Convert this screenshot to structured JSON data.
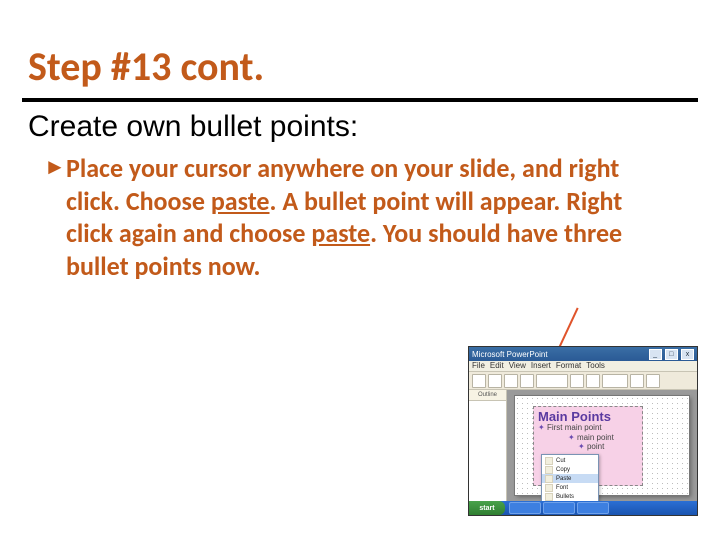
{
  "title": "Step #13 cont.",
  "subtitle": "Create own bullet points:",
  "bullet_glyph": "►",
  "body_parts": {
    "p1": "Place your cursor anywhere on your slide, and right click. Choose ",
    "paste1": "paste",
    "p2": ". A bullet point will appear. Right click again and choose ",
    "paste2": "paste",
    "p3": ". You should have three bullet points now."
  },
  "screenshot": {
    "window_title": "Microsoft PowerPoint",
    "menu_items": [
      "File",
      "Edit",
      "View",
      "Insert",
      "Format",
      "Tools"
    ],
    "outline_tab": "Outline",
    "pink_title": "Main Points",
    "pink_items": [
      "First main point",
      "main point",
      "point"
    ],
    "context_menu": [
      "Cut",
      "Copy",
      "Paste",
      "Font",
      "Bullets"
    ],
    "context_selected_index": 2,
    "start_label": "start"
  }
}
